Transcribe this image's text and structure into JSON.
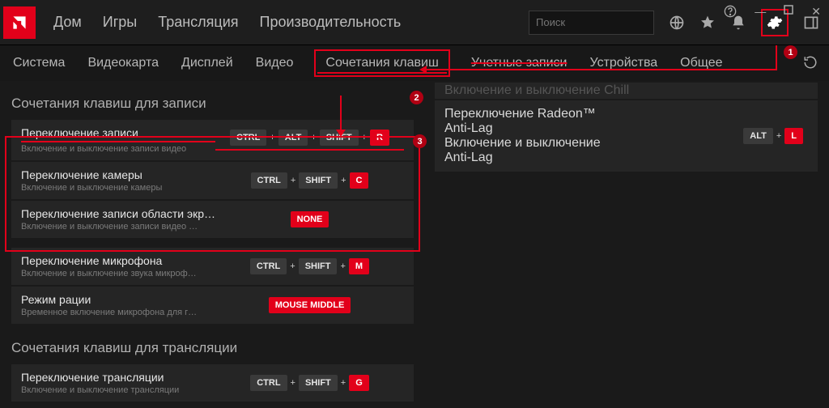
{
  "mainnav": {
    "home": "Дом",
    "games": "Игры",
    "stream": "Трансляция",
    "perf": "Производительность"
  },
  "search": {
    "placeholder": "Поиск"
  },
  "subnav": {
    "system": "Система",
    "gpu": "Видеокарта",
    "display": "Дисплей",
    "video": "Видео",
    "hotkeys": "Сочетания клавиш",
    "accounts": "Учетные записи",
    "devices": "Устройства",
    "general": "Общее"
  },
  "sections": {
    "recording": "Сочетания клавиш для записи",
    "streaming": "Сочетания клавиш для трансляции"
  },
  "rows": {
    "rec_toggle": {
      "t": "Переключение записи",
      "s": "Включение и выключение записи видео"
    },
    "cam_toggle": {
      "t": "Переключение камеры",
      "s": "Включение и выключение камеры"
    },
    "region_rec": {
      "t": "Переключение записи области экра…",
      "s": "Включение и выключение записи видео …"
    },
    "mic_toggle": {
      "t": "Переключение микрофона",
      "s": "Включение и выключение звука микроф…"
    },
    "ptt": {
      "t": "Режим рации",
      "s": "Временное включение микрофона для г…"
    },
    "stream_toggle": {
      "t": "Переключение трансляции",
      "s": "Включение и выключение трансляции"
    },
    "antilag": {
      "t": "Переключение Radeon™ Anti-Lag",
      "s": "Включение и выключение Anti-Lag"
    }
  },
  "keys": {
    "ctrl": "CTRL",
    "alt": "ALT",
    "shift": "SHIFT",
    "R": "R",
    "C": "C",
    "M": "M",
    "L": "L",
    "G": "G",
    "none": "NONE",
    "mmiddle": "MOUSE MIDDLE"
  },
  "badges": {
    "b1": "1",
    "b2": "2",
    "b3": "3"
  }
}
